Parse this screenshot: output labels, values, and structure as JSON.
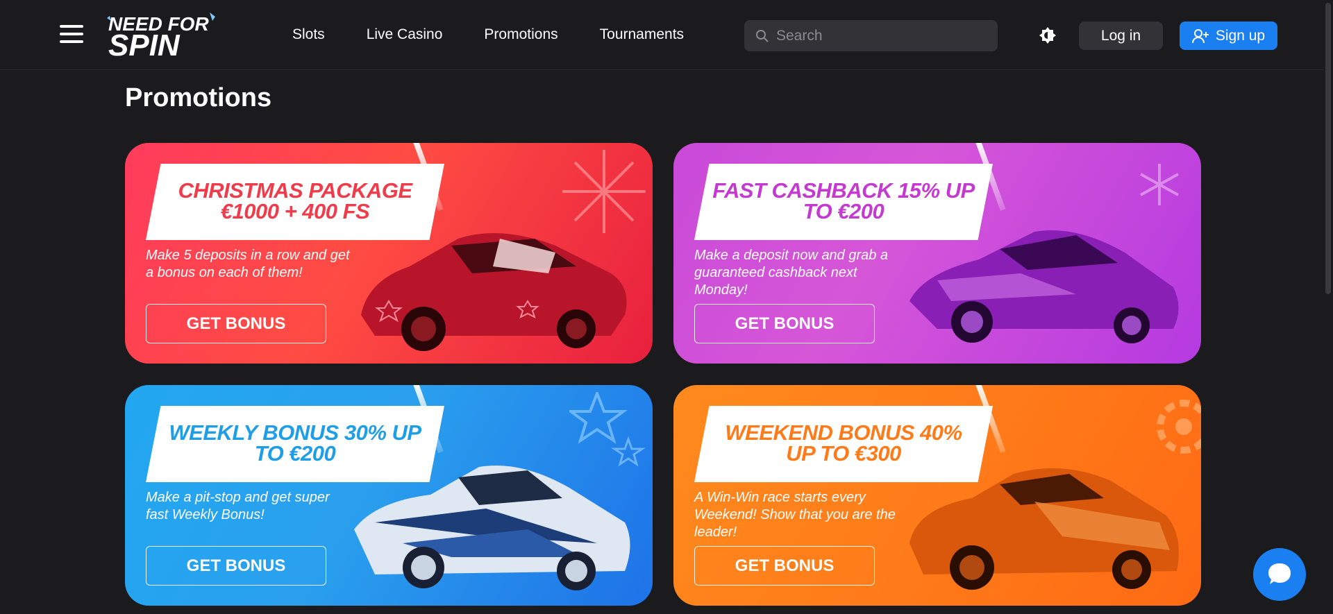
{
  "header": {
    "logo_text_top": "NEED FOR",
    "logo_text_bottom": "SPIN",
    "nav": [
      "Slots",
      "Live Casino",
      "Promotions",
      "Tournaments"
    ],
    "search_placeholder": "Search",
    "login_label": "Log in",
    "signup_label": "Sign up"
  },
  "page": {
    "title": "Promotions"
  },
  "promos": [
    {
      "title": "CHRISTMAS PACKAGE €1000 + 400 FS",
      "description": "Make 5 deposits in a row and get a bonus on each of them!",
      "button": "GET BONUS",
      "color": "#ff4c43"
    },
    {
      "title": "FAST CASHBACK 15% UP TO €200",
      "description": "Make a deposit now and grab a guaranteed cashback next Monday!",
      "button": "GET BONUS",
      "color": "#d656d8"
    },
    {
      "title": "WEEKLY BONUS 30% UP TO €200",
      "description": "Make a pit-stop and get super fast Weekly Bonus!",
      "button": "GET BONUS",
      "color": "#2aa0ee"
    },
    {
      "title": "WEEKEND BONUS 40% UP TO €300",
      "description": "A Win-Win race starts every Weekend! Show that you are the leader!",
      "button": "GET BONUS",
      "color": "#ff7d1a"
    }
  ],
  "icons": {
    "menu": "hamburger-menu-icon",
    "search": "search-icon",
    "theme": "theme-toggle-icon",
    "signup": "user-plus-icon",
    "chat": "chat-icon"
  }
}
